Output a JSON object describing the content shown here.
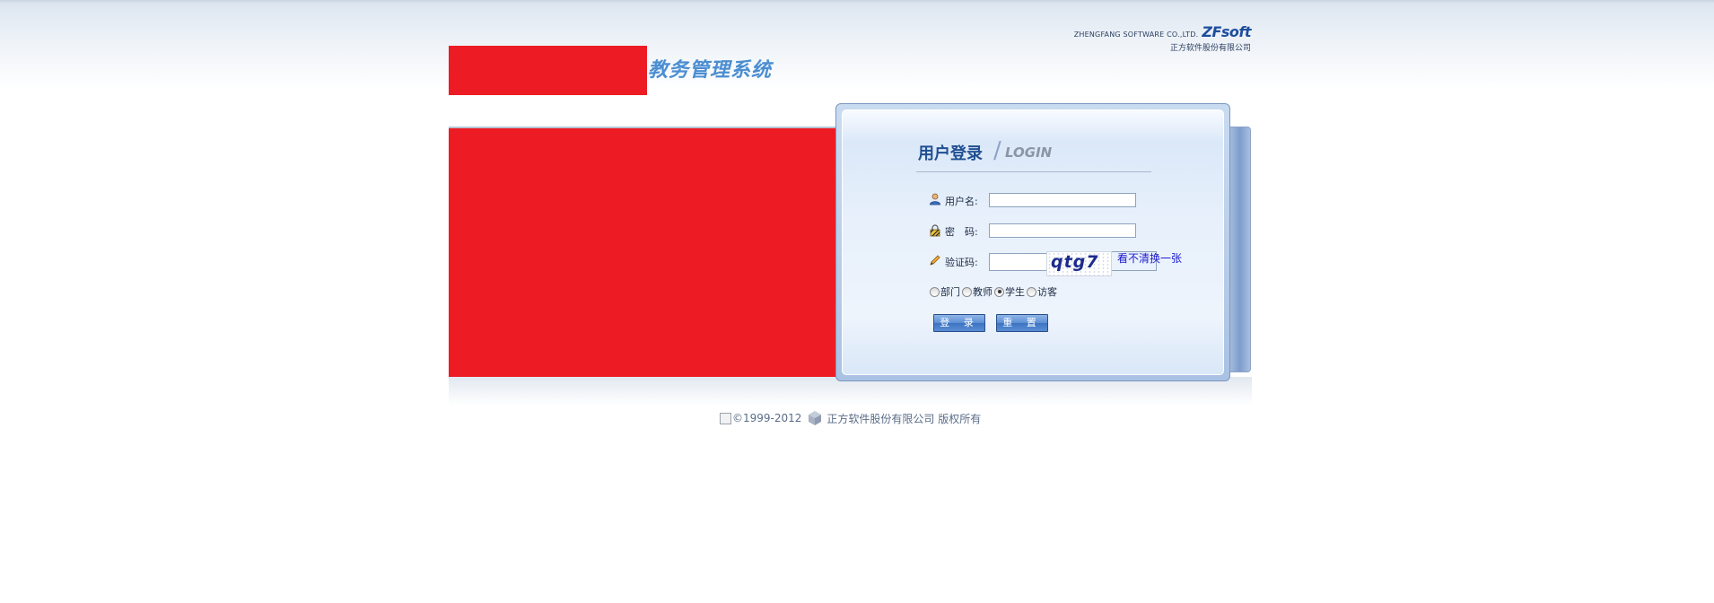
{
  "header": {
    "company_en": "ZHENGFANG SOFTWARE CO.,LTD.",
    "brand_logo": "ZFsoft",
    "company_cn": "正方软件股份有限公司",
    "system_title": "教务管理系统"
  },
  "login": {
    "title_cn": "用户登录",
    "title_en": "LOGIN",
    "username_label": "用户名:",
    "username_value": "",
    "password_label": "密　码:",
    "password_value": "",
    "captcha_label": "验证码:",
    "captcha_value": "",
    "captcha_text": "qtg7",
    "refresh_link": "看不清换一张",
    "roles": [
      {
        "label": "部门",
        "checked": false
      },
      {
        "label": "教师",
        "checked": false
      },
      {
        "label": "学生",
        "checked": true
      },
      {
        "label": "访客",
        "checked": false
      }
    ],
    "login_button": "登 录",
    "reset_button": "重 置"
  },
  "footer": {
    "copyright": "©1999-2012",
    "company": "正方软件股份有限公司 版权所有"
  },
  "colors": {
    "redaction": "#ed1c24",
    "accent": "#1f4f92",
    "link": "#1a1ad0"
  },
  "icons": [
    "user-icon",
    "lock-icon",
    "pencil-icon",
    "broken-image-icon",
    "zfsoft-logo-icon"
  ]
}
